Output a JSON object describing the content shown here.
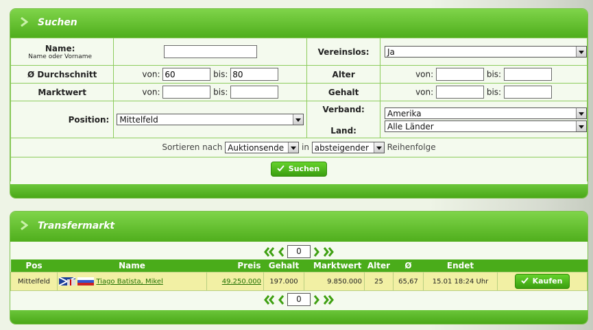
{
  "search": {
    "title": "Suchen",
    "name_label": "Name:",
    "name_hint": "Name oder Vorname",
    "name_value": "",
    "vereinslos_label": "Vereinslos:",
    "vereinslos_value": "Ja",
    "avg_label": "Ø Durchschnitt",
    "von": "von:",
    "bis": "bis:",
    "avg_from": "60",
    "avg_to": "80",
    "alter_label": "Alter",
    "alter_from": "",
    "alter_to": "",
    "marktwert_label": "Marktwert",
    "marktwert_from": "",
    "marktwert_to": "",
    "gehalt_label": "Gehalt",
    "gehalt_from": "",
    "gehalt_to": "",
    "position_label": "Position:",
    "position_value": "Mittelfeld",
    "verband_label": "Verband:",
    "verband_value": "Amerika",
    "land_label": "Land:",
    "land_value": "Alle Länder",
    "sort_prefix": "Sortieren nach",
    "sort_field": "Auktionsende",
    "sort_in": "in",
    "sort_order": "absteigender",
    "sort_suffix": "Reihenfolge",
    "submit_label": "Suchen"
  },
  "transfer": {
    "title": "Transfermarkt",
    "page": "0",
    "columns": [
      "Pos",
      "Name",
      "Preis",
      "Gehalt",
      "Marktwert",
      "Alter",
      "Ø",
      "Endet"
    ],
    "rows": [
      {
        "pos": "Mittelfeld",
        "name": "Tiago Batista, Mikel",
        "preis": "49.250.000",
        "gehalt": "197.000",
        "marktwert": "9.850.000",
        "alter": "25",
        "avg": "65,67",
        "endet": "15.01 18:24 Uhr",
        "buy_label": "Kaufen"
      }
    ]
  },
  "colors": {
    "header_green": "#4fae1c",
    "row_yellow": "#f2f0a4",
    "link_green": "#207000"
  }
}
